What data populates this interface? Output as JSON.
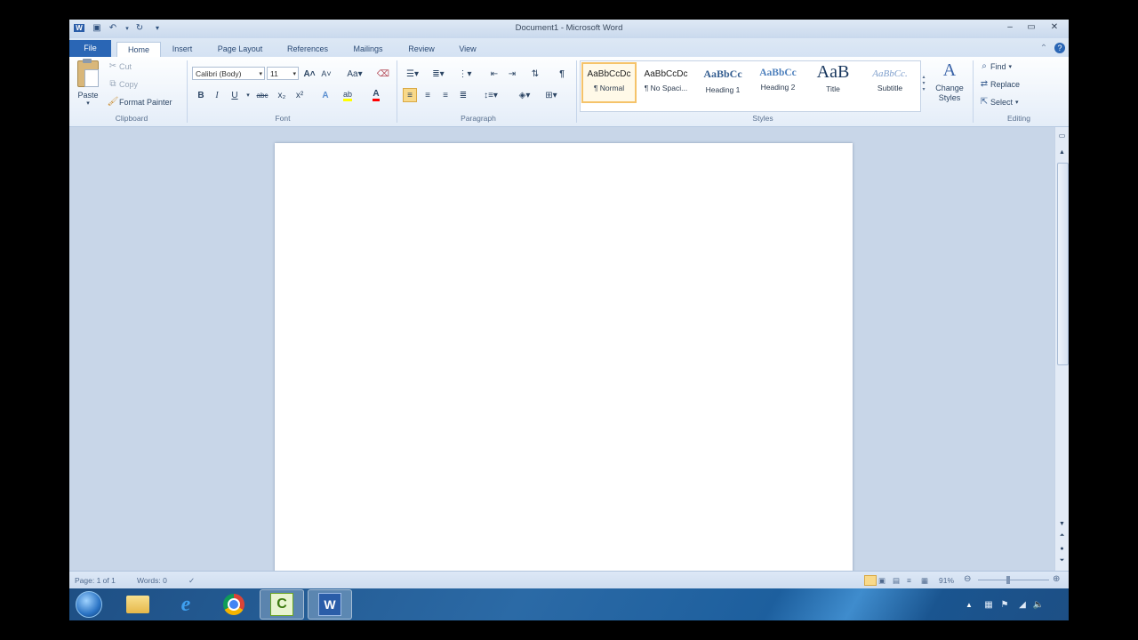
{
  "window": {
    "title": "Document1 - Microsoft Word"
  },
  "tabs": [
    "File",
    "Home",
    "Insert",
    "Page Layout",
    "References",
    "Mailings",
    "Review",
    "View"
  ],
  "clipboard": {
    "paste": "Paste",
    "cut": "Cut",
    "copy": "Copy",
    "format_painter": "Format Painter",
    "label": "Clipboard"
  },
  "font": {
    "name": "Calibri (Body)",
    "size": "11",
    "label": "Font"
  },
  "paragraph": {
    "label": "Paragraph"
  },
  "styles": {
    "label": "Styles",
    "items": [
      {
        "preview": "AaBbCcDc",
        "name": "¶ Normal"
      },
      {
        "preview": "AaBbCcDc",
        "name": "¶ No Spaci..."
      },
      {
        "preview": "AaBbCc",
        "name": "Heading 1"
      },
      {
        "preview": "AaBbCc",
        "name": "Heading 2"
      },
      {
        "preview": "AaB",
        "name": "Title"
      },
      {
        "preview": "AaBbCc.",
        "name": "Subtitle"
      }
    ],
    "change_styles": "Change Styles"
  },
  "editing": {
    "find": "Find",
    "replace": "Replace",
    "select": "Select",
    "label": "Editing"
  },
  "status": {
    "page": "Page: 1 of 1",
    "words": "Words: 0",
    "zoom": "91%"
  },
  "colors": {
    "file_tab": "#2a66b5",
    "highlight": "#ffff00",
    "font_color": "#ff0000",
    "selected_style": "#f5c36a"
  },
  "icons": [
    "word-icon",
    "save-icon",
    "undo-icon",
    "redo-icon",
    "paste-icon",
    "scissors-icon",
    "copy-icon",
    "brush-icon",
    "start-orb-icon",
    "folder-icon",
    "ie-icon",
    "chrome-icon",
    "camtasia-icon",
    "word-taskbar-icon"
  ]
}
